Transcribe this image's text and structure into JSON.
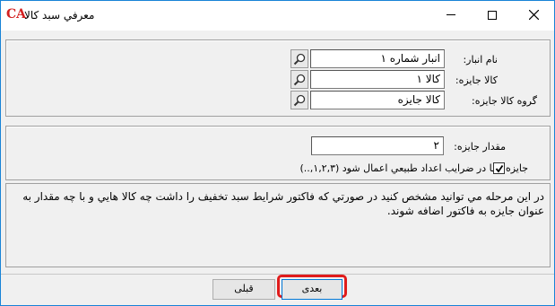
{
  "window": {
    "title": "معرفي سبد کالا",
    "logo": "CA",
    "controls": {
      "minimize": "minimize-icon",
      "maximize": "maximize-icon",
      "close": "close-icon"
    }
  },
  "section1": {
    "fields": [
      {
        "label": "نام انبار:",
        "value": "انبار شماره ۱"
      },
      {
        "label": "کالا جايزه:",
        "value": "کالا ۱"
      },
      {
        "label": "گروه کالا جايزه:",
        "value": "کالا جايزه"
      }
    ],
    "lookup_icon": "magnifier-icon"
  },
  "section2": {
    "quantity_label": "مقدار جايزه:",
    "quantity_value": "۲",
    "checkbox_label": "جايزه تنها در ضرايب اعداد طبيعي اعمال شود (۱,۲,۳,..)",
    "checkbox_checked": true
  },
  "info": {
    "text": "در اين مرحله مي توانيد مشخص کنيد در صورتي که فاکتور شرايط سبد تخفيف را داشت چه کالا هايي و با چه مقدار به عنوان جايزه به فاکتور اضافه شوند."
  },
  "buttons": {
    "prev_label": "قبلی",
    "next_label": "بعدی"
  },
  "colors": {
    "focus_highlight": "#e01c1c",
    "window_border": "#1883d7",
    "logo": "#d32020"
  }
}
